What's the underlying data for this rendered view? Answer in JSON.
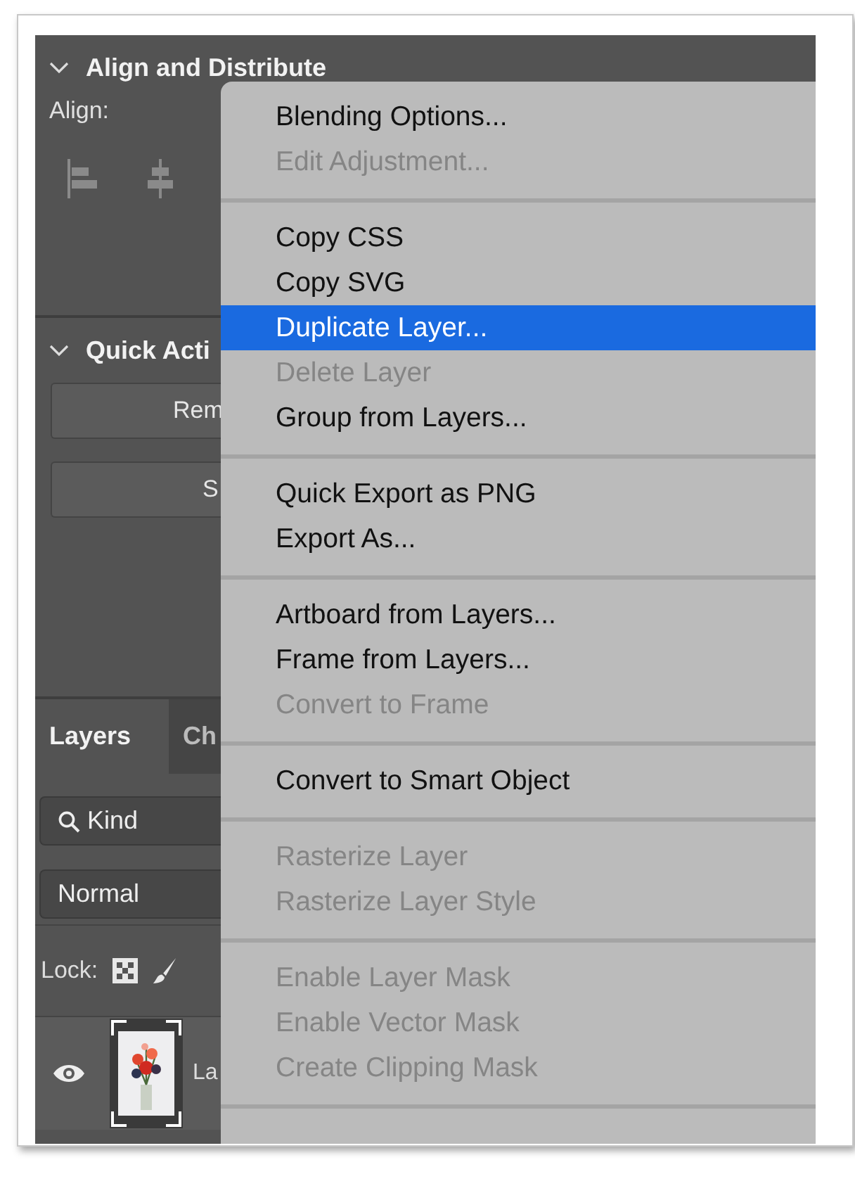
{
  "align_panel": {
    "title": "Align and Distribute",
    "expanded": true,
    "align_label": "Align:"
  },
  "quick_actions_panel": {
    "title": "Quick Acti",
    "expanded": true,
    "buttons": [
      "Rem",
      "S"
    ]
  },
  "layers_panel": {
    "tabs": [
      {
        "label": "Layers",
        "selected": true
      },
      {
        "label": "Ch",
        "selected": false
      }
    ],
    "filter": {
      "value": "Kind"
    },
    "blend_mode": {
      "value": "Normal"
    },
    "lock_label": "Lock:",
    "layers": [
      {
        "name": "La",
        "visible": true,
        "kind": "picture"
      }
    ]
  },
  "context_menu": {
    "items": [
      {
        "kind": "item",
        "label": "Blending Options...",
        "disabled": false,
        "selected": false
      },
      {
        "kind": "item",
        "label": "Edit Adjustment...",
        "disabled": true,
        "selected": false
      },
      {
        "kind": "separator"
      },
      {
        "kind": "item",
        "label": "Copy CSS",
        "disabled": false,
        "selected": false
      },
      {
        "kind": "item",
        "label": "Copy SVG",
        "disabled": false,
        "selected": false
      },
      {
        "kind": "item",
        "label": "Duplicate Layer...",
        "disabled": false,
        "selected": true
      },
      {
        "kind": "item",
        "label": "Delete Layer",
        "disabled": true,
        "selected": false
      },
      {
        "kind": "item",
        "label": "Group from Layers...",
        "disabled": false,
        "selected": false
      },
      {
        "kind": "separator"
      },
      {
        "kind": "item",
        "label": "Quick Export as PNG",
        "disabled": false,
        "selected": false
      },
      {
        "kind": "item",
        "label": "Export As...",
        "disabled": false,
        "selected": false
      },
      {
        "kind": "separator"
      },
      {
        "kind": "item",
        "label": "Artboard from Layers...",
        "disabled": false,
        "selected": false
      },
      {
        "kind": "item",
        "label": "Frame from Layers...",
        "disabled": false,
        "selected": false
      },
      {
        "kind": "item",
        "label": "Convert to Frame",
        "disabled": true,
        "selected": false
      },
      {
        "kind": "separator"
      },
      {
        "kind": "item",
        "label": "Convert to Smart Object",
        "disabled": false,
        "selected": false
      },
      {
        "kind": "separator"
      },
      {
        "kind": "item",
        "label": "Rasterize Layer",
        "disabled": true,
        "selected": false
      },
      {
        "kind": "item",
        "label": "Rasterize Layer Style",
        "disabled": true,
        "selected": false
      },
      {
        "kind": "separator"
      },
      {
        "kind": "item",
        "label": "Enable Layer Mask",
        "disabled": true,
        "selected": false
      },
      {
        "kind": "item",
        "label": "Enable Vector Mask",
        "disabled": true,
        "selected": false
      },
      {
        "kind": "item",
        "label": "Create Clipping Mask",
        "disabled": true,
        "selected": false
      },
      {
        "kind": "separator"
      }
    ]
  }
}
